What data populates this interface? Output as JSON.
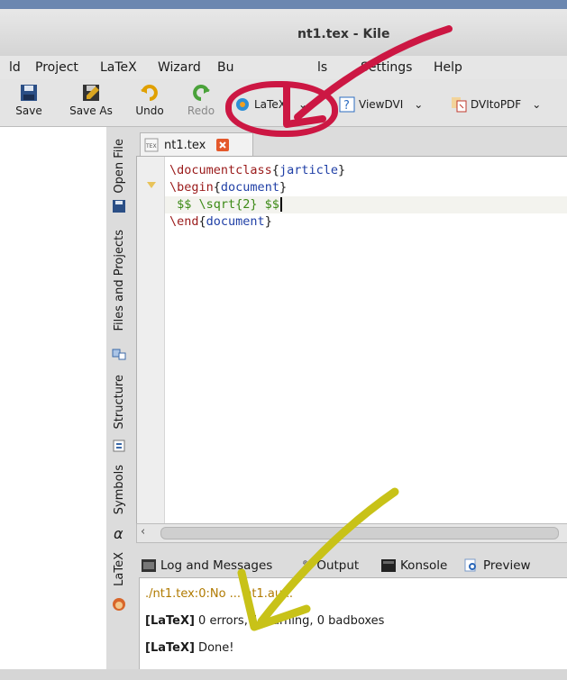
{
  "window": {
    "title": "nt1.tex - Kile"
  },
  "menubar": {
    "items": [
      "ld",
      "Project",
      "LaTeX",
      "Wizard",
      "Bu",
      "ls",
      "Settings",
      "Help"
    ]
  },
  "toolbar": {
    "save": "Save",
    "save_as": "Save As",
    "undo": "Undo",
    "redo": "Redo",
    "latex": "LaTeX",
    "viewdvi": "ViewDVI",
    "dvitopdf": "DVItoPDF"
  },
  "side_tabs": {
    "open_file": "Open File",
    "files_projects": "Files and Projects",
    "structure": "Structure",
    "symbols": "Symbols",
    "latex": "LaTeX",
    "alpha": "α"
  },
  "editor": {
    "tab_label": "nt1.tex",
    "lines": [
      {
        "cmd": "\\documentclass",
        "open": "{",
        "arg": "jarticle",
        "close": "}"
      },
      {
        "cmd": "\\begin",
        "open": "{",
        "arg": "document",
        "close": "}"
      },
      {
        "math": " $$ \\sqrt{2} $$"
      },
      {
        "cmd": "\\end",
        "open": "{",
        "arg": "document",
        "close": "}"
      }
    ]
  },
  "bottom_tabs": {
    "log": "Log and Messages",
    "output": "Output",
    "konsole": "Konsole",
    "preview": "Preview"
  },
  "log": {
    "line1": "./nt1.tex:0:No ... nt1.aux.",
    "line2_tag": "[LaTeX]",
    "line2_text": " 0 errors, 1 warning, 0 badboxes",
    "line3_tag": "[LaTeX]",
    "line3_text": " Done!"
  },
  "colors": {
    "annotation_red": "#cc1743",
    "annotation_yellow": "#c8c218"
  }
}
